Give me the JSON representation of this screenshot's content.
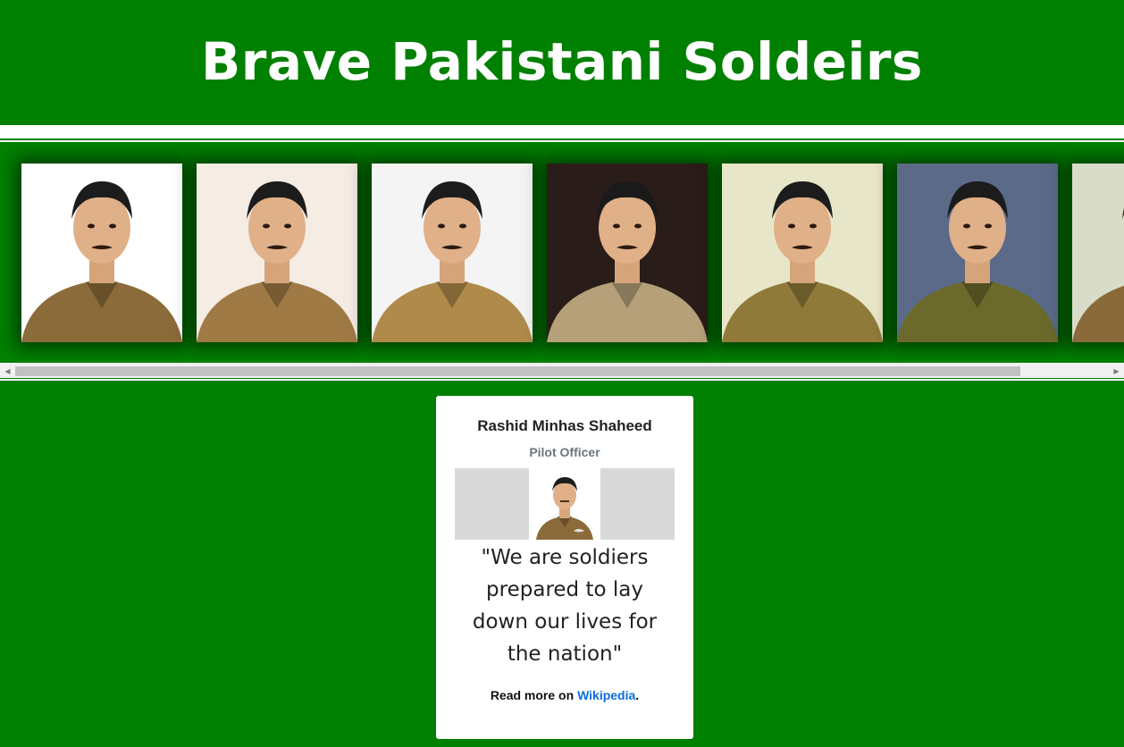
{
  "header": {
    "title": "Brave Pakistani Soldeirs"
  },
  "gallery": {
    "items": [
      {
        "icon": "soldier-portrait-1",
        "bg": "#ffffff",
        "uniform": "#8b6b3a",
        "hair": "#1c1c1c"
      },
      {
        "icon": "soldier-portrait-2",
        "bg": "#f5ece4",
        "uniform": "#a07a45",
        "hair": "#1c1c1c"
      },
      {
        "icon": "soldier-portrait-3",
        "bg": "#f4f4f4",
        "uniform": "#b08a4a",
        "hair": "#1c1c1c"
      },
      {
        "icon": "soldier-portrait-4",
        "bg": "#2a1c18",
        "uniform": "#b5a07a",
        "hair": "#1a1a1a"
      },
      {
        "icon": "soldier-portrait-5",
        "bg": "#e8e6c8",
        "uniform": "#8f7a3a",
        "hair": "#1c1c1c"
      },
      {
        "icon": "soldier-portrait-6",
        "bg": "#5a6a88",
        "uniform": "#6b6a2a",
        "hair": "#1c1c1c"
      },
      {
        "icon": "soldier-portrait-7",
        "bg": "#d8dcc8",
        "uniform": "#8a6a3a",
        "hair": "#3a3020"
      }
    ]
  },
  "card": {
    "name": "Rashid Minhas Shaheed",
    "rank": "Pilot Officer",
    "quote": "\"We are soldiers prepared to lay down our lives for the nation\"",
    "more_prefix": "Read more on ",
    "more_link": "Wikipedia",
    "more_suffix": "."
  },
  "colors": {
    "brand_green": "#008000",
    "link": "#0a6edc"
  }
}
